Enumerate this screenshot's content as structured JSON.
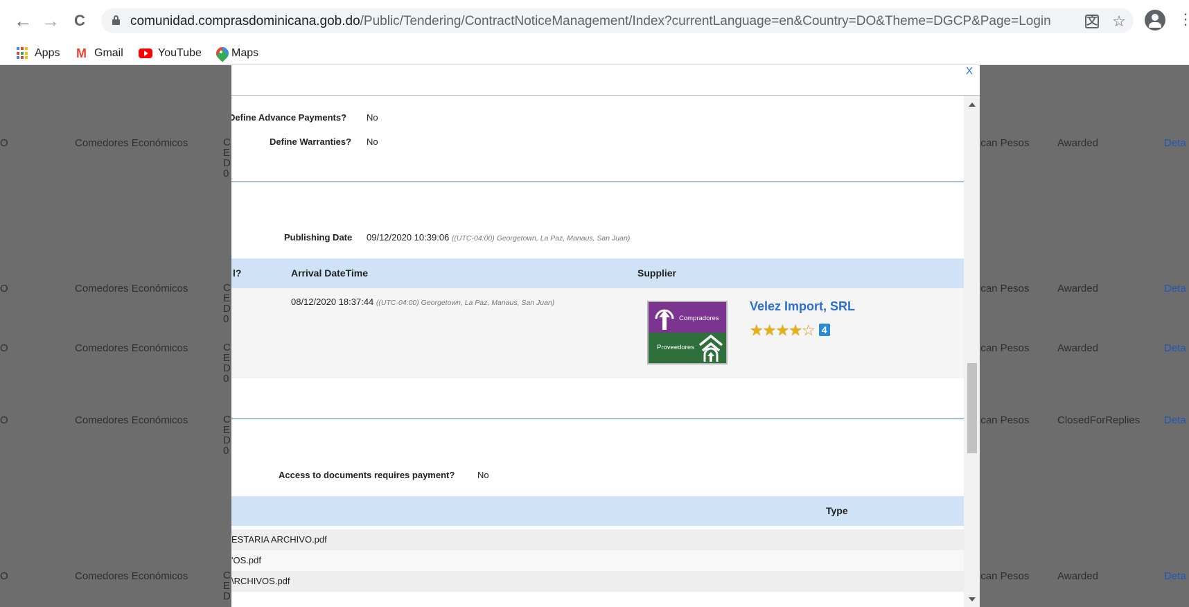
{
  "browser": {
    "url_host": "comunidad.comprasdominicana.gob.do",
    "url_path": "/Public/Tendering/ContractNoticeManagement/Index?currentLanguage=en&Country=DO&Theme=DGCP&Page=Login",
    "back_icon": "←",
    "forward_icon": "→",
    "reload_icon": "C",
    "translate_icon": "translate-icon",
    "star_icon": "☆",
    "menu_icon": "⋮"
  },
  "bookmarks": [
    {
      "label": "Apps"
    },
    {
      "label": "Gmail"
    },
    {
      "label": "YouTube"
    },
    {
      "label": "Maps"
    }
  ],
  "background_table": {
    "entity": "Comedores Económicos",
    "letters": [
      "C",
      "E",
      "D",
      "0"
    ],
    "currency_fragment": "ican Pesos",
    "detail_fragment": "Deta",
    "left_fragment": "O",
    "rows": [
      {
        "status": "Awarded"
      },
      {
        "status": "Awarded"
      },
      {
        "status": "Awarded"
      },
      {
        "status": "ClosedForReplies"
      },
      {
        "status": "Awarded"
      }
    ]
  },
  "modal": {
    "close_label": "X",
    "advance_payments_label": "Define Advance Payments?",
    "advance_payments_value": "No",
    "warranties_label": "Define Warranties?",
    "warranties_value": "No",
    "publishing_label": "Publishing Date",
    "publishing_value": "09/12/2020 10:39:06",
    "timezone": "((UTC-04:00) Georgetown, La Paz, Manaus, San Juan)",
    "offers_table": {
      "col_partial": "l?",
      "col_arrival": "Arrival DateTime",
      "col_supplier": "Supplier",
      "row": {
        "arrival": "08/12/2020 18:37:44",
        "timezone": "((UTC-04:00) Georgetown, La Paz, Manaus, San Juan)",
        "logo_top": "Compradores",
        "logo_bottom": "Proveedores",
        "supplier": "Velez Import, SRL",
        "rating": "4",
        "stars_filled": 4,
        "stars_total": 5
      }
    },
    "documents_payment_label": "Access to documents requires payment?",
    "documents_payment_value": "No",
    "documents_table": {
      "col_type": "Type",
      "rows": [
        {
          "name": "ESTARIA ARCHIVO.pdf"
        },
        {
          "name": "'OS.pdf"
        },
        {
          "name": "\\RCHIVOS.pdf"
        }
      ]
    }
  }
}
